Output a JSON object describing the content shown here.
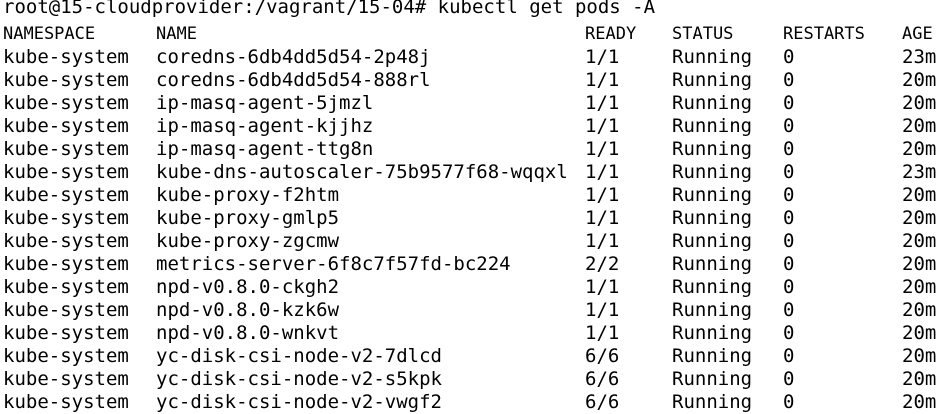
{
  "terminal": {
    "prompt_line": "root@15-cloudprovider:/vagrant/15-04# kubectl get pods -A",
    "headers": {
      "namespace": "NAMESPACE",
      "name": "NAME",
      "ready": "READY",
      "status": "STATUS",
      "restarts": "RESTARTS",
      "age": "AGE"
    },
    "rows": [
      {
        "namespace": "kube-system",
        "name": "coredns-6db4dd5d54-2p48j",
        "ready": "1/1",
        "status": "Running",
        "restarts": "0",
        "age": "23m"
      },
      {
        "namespace": "kube-system",
        "name": "coredns-6db4dd5d54-888rl",
        "ready": "1/1",
        "status": "Running",
        "restarts": "0",
        "age": "20m"
      },
      {
        "namespace": "kube-system",
        "name": "ip-masq-agent-5jmzl",
        "ready": "1/1",
        "status": "Running",
        "restarts": "0",
        "age": "20m"
      },
      {
        "namespace": "kube-system",
        "name": "ip-masq-agent-kjjhz",
        "ready": "1/1",
        "status": "Running",
        "restarts": "0",
        "age": "20m"
      },
      {
        "namespace": "kube-system",
        "name": "ip-masq-agent-ttg8n",
        "ready": "1/1",
        "status": "Running",
        "restarts": "0",
        "age": "20m"
      },
      {
        "namespace": "kube-system",
        "name": "kube-dns-autoscaler-75b9577f68-wqqxl",
        "ready": "1/1",
        "status": "Running",
        "restarts": "0",
        "age": "23m"
      },
      {
        "namespace": "kube-system",
        "name": "kube-proxy-f2htm",
        "ready": "1/1",
        "status": "Running",
        "restarts": "0",
        "age": "20m"
      },
      {
        "namespace": "kube-system",
        "name": "kube-proxy-gmlp5",
        "ready": "1/1",
        "status": "Running",
        "restarts": "0",
        "age": "20m"
      },
      {
        "namespace": "kube-system",
        "name": "kube-proxy-zgcmw",
        "ready": "1/1",
        "status": "Running",
        "restarts": "0",
        "age": "20m"
      },
      {
        "namespace": "kube-system",
        "name": "metrics-server-6f8c7f57fd-bc224",
        "ready": "2/2",
        "status": "Running",
        "restarts": "0",
        "age": "20m"
      },
      {
        "namespace": "kube-system",
        "name": "npd-v0.8.0-ckgh2",
        "ready": "1/1",
        "status": "Running",
        "restarts": "0",
        "age": "20m"
      },
      {
        "namespace": "kube-system",
        "name": "npd-v0.8.0-kzk6w",
        "ready": "1/1",
        "status": "Running",
        "restarts": "0",
        "age": "20m"
      },
      {
        "namespace": "kube-system",
        "name": "npd-v0.8.0-wnkvt",
        "ready": "1/1",
        "status": "Running",
        "restarts": "0",
        "age": "20m"
      },
      {
        "namespace": "kube-system",
        "name": "yc-disk-csi-node-v2-7dlcd",
        "ready": "6/6",
        "status": "Running",
        "restarts": "0",
        "age": "20m"
      },
      {
        "namespace": "kube-system",
        "name": "yc-disk-csi-node-v2-s5kpk",
        "ready": "6/6",
        "status": "Running",
        "restarts": "0",
        "age": "20m"
      },
      {
        "namespace": "kube-system",
        "name": "yc-disk-csi-node-v2-vwgf2",
        "ready": "6/6",
        "status": "Running",
        "restarts": "0",
        "age": "20m"
      }
    ]
  }
}
